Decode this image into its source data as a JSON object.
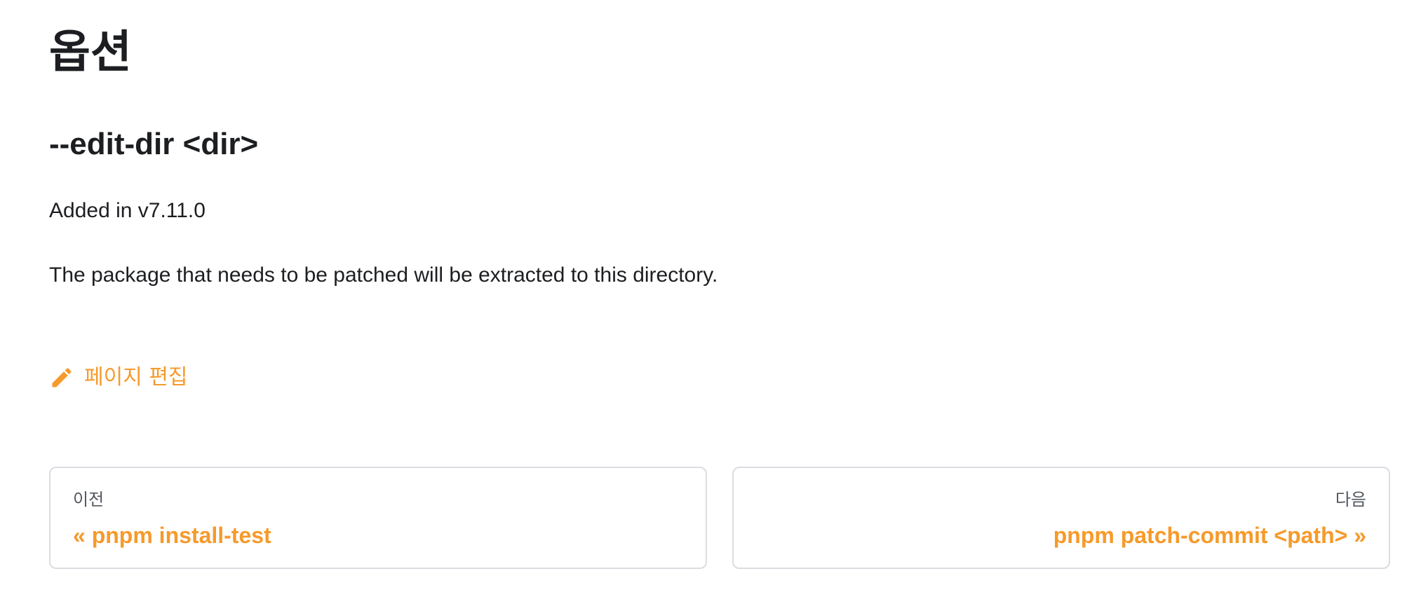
{
  "heading": "옵션",
  "option": {
    "name": "--edit-dir <dir>",
    "added": "Added in v7.11.0",
    "description": "The package that needs to be patched will be extracted to this directory."
  },
  "edit_link": {
    "label": "페이지 편집",
    "icon": "pencil-icon",
    "color": "#f69a2b"
  },
  "pagination": {
    "prev": {
      "sublabel": "이전",
      "title": "« pnpm install-test"
    },
    "next": {
      "sublabel": "다음",
      "title": "pnpm patch-commit <path> »"
    }
  }
}
